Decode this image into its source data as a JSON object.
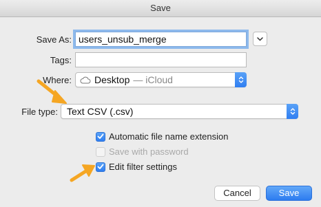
{
  "window": {
    "title": "Save"
  },
  "form": {
    "save_as_label": "Save As:",
    "save_as_value": "users_unsub_merge",
    "tags_label": "Tags:",
    "tags_value": "",
    "where_label": "Where:",
    "where_location": "Desktop",
    "where_suffix": "— iCloud",
    "file_type_label": "File type:",
    "file_type_value": "Text CSV (.csv)"
  },
  "options": [
    {
      "label": "Automatic file name extension",
      "checked": true,
      "enabled": true
    },
    {
      "label": "Save with password",
      "checked": false,
      "enabled": false
    },
    {
      "label": "Edit filter settings",
      "checked": true,
      "enabled": true
    }
  ],
  "buttons": {
    "cancel": "Cancel",
    "save": "Save"
  },
  "colors": {
    "accent": "#2f7ef1",
    "annotation_arrow": "#f5a623"
  },
  "icons": {
    "expand": "chevron-down-icon",
    "location": "cloud-icon",
    "popup": "updown-chevron-icon",
    "check": "checkmark-icon",
    "annotation": "orange-arrow-icon"
  }
}
